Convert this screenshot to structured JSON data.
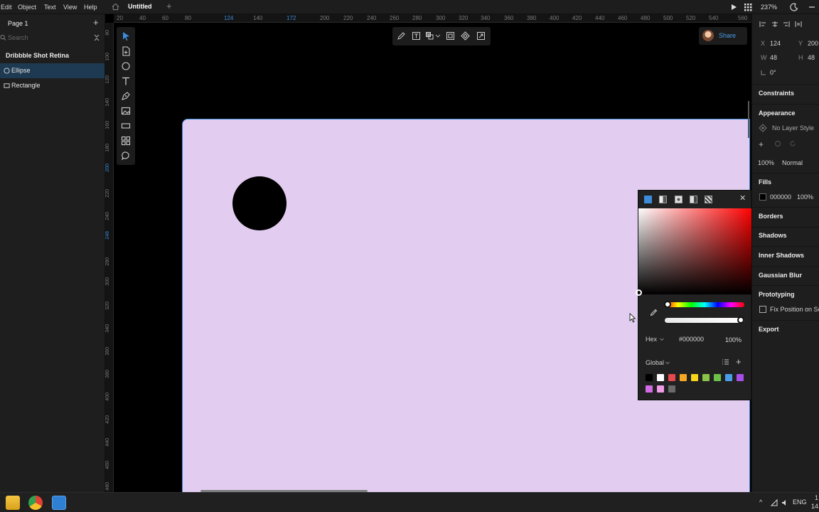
{
  "menubar": {
    "items": [
      "Edit",
      "Object",
      "Text",
      "View",
      "Help"
    ],
    "doc_tab": "Untitled",
    "new_tab": "+",
    "zoom": "237%"
  },
  "layers": {
    "page_label": "Page 1",
    "add": "+",
    "search_placeholder": "Search",
    "group_name": "Dribbble Shot Retina",
    "rows": [
      {
        "label": "Ellipse",
        "icon": "ellipse-icon",
        "selected": true
      },
      {
        "label": "Rectangle",
        "icon": "rectangle-icon",
        "selected": false
      }
    ]
  },
  "ruler_h": [
    "20",
    "40",
    "60",
    "80",
    "124",
    "140",
    "172",
    "200",
    "220",
    "240",
    "260",
    "280",
    "300",
    "320",
    "340",
    "360",
    "380",
    "400",
    "420",
    "440",
    "460",
    "480",
    "500",
    "520",
    "540",
    "560"
  ],
  "ruler_v": [
    "80",
    "100",
    "120",
    "140",
    "160",
    "180",
    "200",
    "220",
    "240",
    "248",
    "280",
    "300",
    "320",
    "340",
    "360",
    "380",
    "400",
    "420",
    "440",
    "460",
    "480"
  ],
  "share": {
    "label": "Share"
  },
  "picker": {
    "mode": "Hex",
    "hex": "#000000",
    "opacity": "100%",
    "palette_label": "Global",
    "add": "+",
    "close": "✕",
    "swatches": [
      "#000000",
      "#ffffff",
      "#e5484d",
      "#f5a623",
      "#f8d31c",
      "#8bc34a",
      "#6cc04a",
      "#4a9ee8",
      "#a84ee8",
      "#d36be5",
      "#f09be8",
      "#6a6a6a"
    ]
  },
  "inspector": {
    "x_label": "X",
    "x_value": "124",
    "y_label": "Y",
    "y_value": "200",
    "w_label": "W",
    "w_value": "48",
    "h_label": "H",
    "h_value": "48",
    "rotation": "0°",
    "constraints": "Constraints",
    "appearance": "Appearance",
    "layer_style": "No Layer Style",
    "opacity": "100%",
    "blend": "Normal",
    "fills": "Fills",
    "fill_hex": "000000",
    "fill_opacity": "100%",
    "borders": "Borders",
    "shadows": "Shadows",
    "inner_shadows": "Inner Shadows",
    "gaussian_blur": "Gaussian Blur",
    "prototyping": "Prototyping",
    "fix_position": "Fix Position on Scroll",
    "export": "Export"
  },
  "taskbar": {
    "lang": "ENG",
    "time": "1",
    "date": "14."
  },
  "colors": {
    "artboard": "#e2cdf0",
    "accent": "#3d8cd9",
    "ellipse": "#000000"
  }
}
